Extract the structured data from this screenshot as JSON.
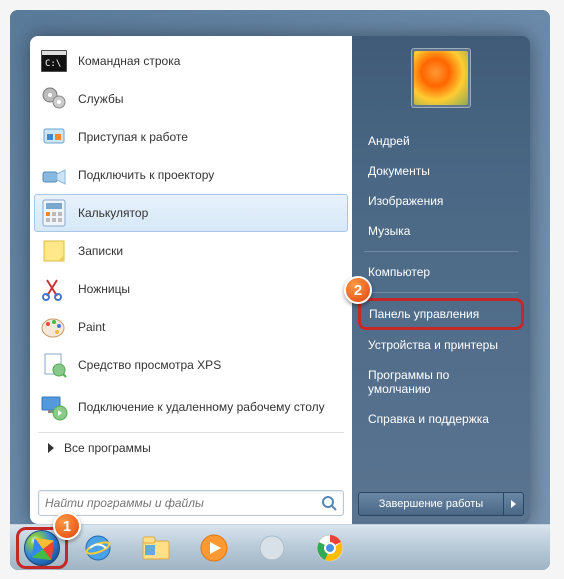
{
  "left_programs": [
    {
      "label": "Командная строка",
      "icon": "command-prompt-icon"
    },
    {
      "label": "Службы",
      "icon": "services-icon"
    },
    {
      "label": "Приступая к работе",
      "icon": "getting-started-icon"
    },
    {
      "label": "Подключить к проектору",
      "icon": "projector-icon"
    },
    {
      "label": "Калькулятор",
      "icon": "calculator-icon",
      "highlighted": true
    },
    {
      "label": "Записки",
      "icon": "sticky-notes-icon"
    },
    {
      "label": "Ножницы",
      "icon": "snipping-tool-icon"
    },
    {
      "label": "Paint",
      "icon": "paint-icon"
    },
    {
      "label": "Средство просмотра XPS",
      "icon": "xps-viewer-icon"
    },
    {
      "label": "Подключение к удаленному рабочему столу",
      "icon": "remote-desktop-icon",
      "tall": true
    }
  ],
  "all_programs_label": "Все программы",
  "search": {
    "placeholder": "Найти программы и файлы"
  },
  "right_items_top": [
    "Андрей",
    "Документы",
    "Изображения",
    "Музыка"
  ],
  "right_items_mid": [
    "Компьютер"
  ],
  "right_items_bottom": [
    {
      "label": "Панель управления",
      "boxed": true
    },
    {
      "label": "Устройства и принтеры"
    },
    {
      "label": "Программы по умолчанию"
    },
    {
      "label": "Справка и поддержка"
    }
  ],
  "shutdown_label": "Завершение работы",
  "step_badges": {
    "1": "1",
    "2": "2"
  }
}
